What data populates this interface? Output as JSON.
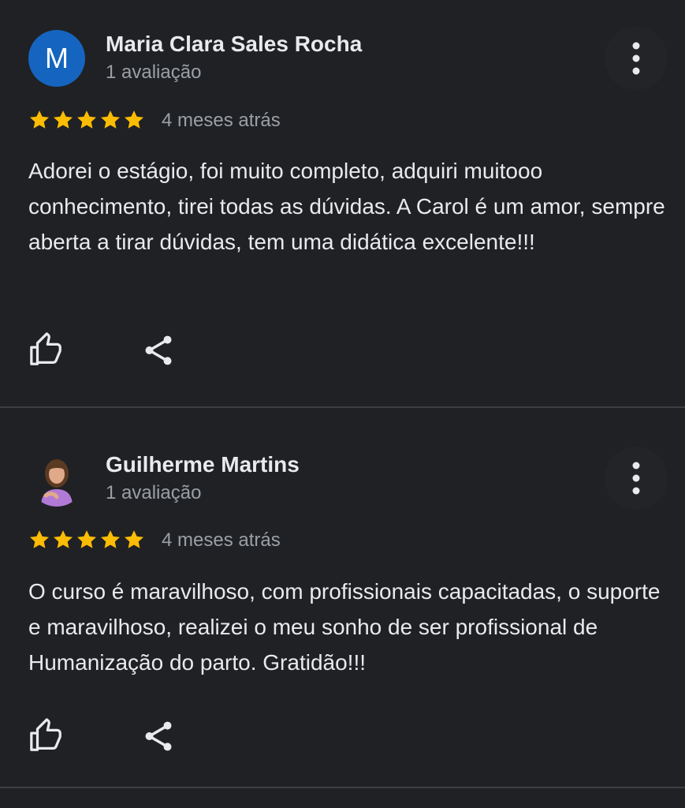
{
  "colors": {
    "background": "#202124",
    "star": "#fbbc04",
    "primary_text": "#e8eaed",
    "secondary_text": "#9aa0a6",
    "divider": "#3c4043",
    "avatar_blue": "#1565c0"
  },
  "reviews": [
    {
      "avatar_letter": "M",
      "author": "Maria Clara Sales Rocha",
      "review_count": "1 avaliação",
      "rating": 5,
      "date": "4 meses atrás",
      "text": "Adorei o estágio, foi muito completo, adquiri muitooo conhecimento, tirei todas as dúvidas. A Carol é um amor, sempre aberta a tirar dúvidas, tem uma didática excelente!!!",
      "icons": {
        "more": "more-vert-icon",
        "like": "thumbs-up-icon",
        "share": "share-icon"
      }
    },
    {
      "avatar_letter": "",
      "author": "Guilherme Martins",
      "review_count": "1 avaliação",
      "rating": 5,
      "date": "4 meses atrás",
      "text": "O curso é maravilhoso, com profissionais capacitadas, o suporte e maravilhoso, realizei o meu sonho de ser profissional de Humanização do parto. Gratidão!!!",
      "icons": {
        "more": "more-vert-icon",
        "like": "thumbs-up-icon",
        "share": "share-icon"
      }
    }
  ]
}
